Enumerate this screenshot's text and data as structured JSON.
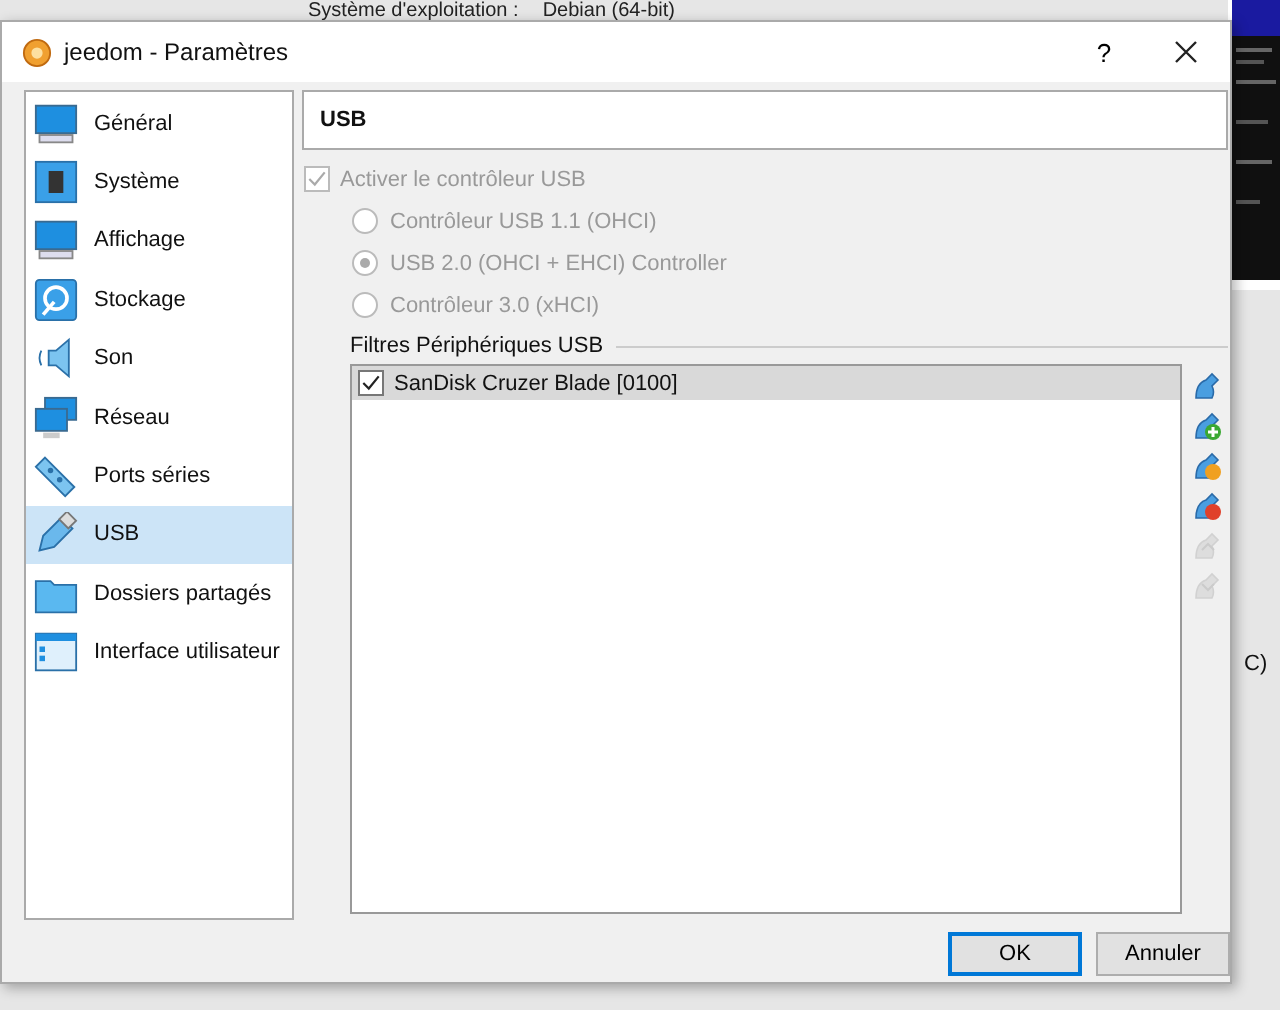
{
  "background": {
    "os_label": "Système d'exploitation :",
    "os_value": "Debian (64-bit)",
    "side_text": "C)"
  },
  "window": {
    "title": "jeedom - Paramètres",
    "help": "?"
  },
  "sidebar": {
    "items": [
      {
        "label": "Général",
        "selected": false
      },
      {
        "label": "Système",
        "selected": false
      },
      {
        "label": "Affichage",
        "selected": false
      },
      {
        "label": "Stockage",
        "selected": false
      },
      {
        "label": "Son",
        "selected": false
      },
      {
        "label": "Réseau",
        "selected": false
      },
      {
        "label": "Ports séries",
        "selected": false
      },
      {
        "label": "USB",
        "selected": true
      },
      {
        "label": "Dossiers partagés",
        "selected": false
      },
      {
        "label": "Interface utilisateur",
        "selected": false
      }
    ]
  },
  "page_title": "USB",
  "enable": {
    "label": "Activer le contrôleur USB",
    "checked": true,
    "disabled": true
  },
  "controllers": [
    {
      "label": "Contrôleur USB 1.1 (OHCI)",
      "selected": false,
      "disabled": true
    },
    {
      "label": "USB 2.0 (OHCI + EHCI) Controller",
      "selected": true,
      "disabled": true
    },
    {
      "label": "Contrôleur 3.0 (xHCI)",
      "selected": false,
      "disabled": true
    }
  ],
  "filters": {
    "label": "Filtres Périphériques USB",
    "items": [
      {
        "label": "SanDisk Cruzer Blade [0100]",
        "checked": true,
        "selected": true
      }
    ]
  },
  "filter_tools": [
    {
      "kind": "new",
      "disabled": false
    },
    {
      "kind": "add",
      "disabled": false
    },
    {
      "kind": "edit",
      "disabled": false
    },
    {
      "kind": "remove",
      "disabled": false
    },
    {
      "kind": "up",
      "disabled": true
    },
    {
      "kind": "down",
      "disabled": true
    }
  ],
  "buttons": [
    {
      "label": "OK",
      "default": true
    },
    {
      "label": "Annuler",
      "default": false
    }
  ]
}
